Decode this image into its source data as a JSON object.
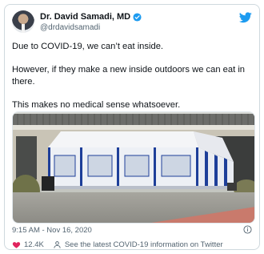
{
  "author": {
    "name": "Dr. David Samadi, MD",
    "handle": "@drdavidsamadi"
  },
  "tweet": {
    "paragraphs": [
      "Due to COVID-19, we can’t eat inside.",
      "However, if they make a new inside outdoors we can eat in there.",
      "This makes no medical sense whatsoever."
    ]
  },
  "meta": {
    "timestamp": "9:15 AM - Nov 16, 2020"
  },
  "actions": {
    "like_count": "12.4K",
    "covid_link": "See the latest COVID-19 information on Twitter"
  },
  "colors": {
    "twitter_blue": "#1d9bf0",
    "like_red": "#e0245e",
    "secondary_text": "#536471",
    "tent_blue": "#1e3f99"
  },
  "icons": {
    "verified": "verified-badge-icon",
    "twitter": "twitter-bird-icon",
    "info": "info-icon",
    "like": "heart-icon",
    "person": "person-icon"
  }
}
